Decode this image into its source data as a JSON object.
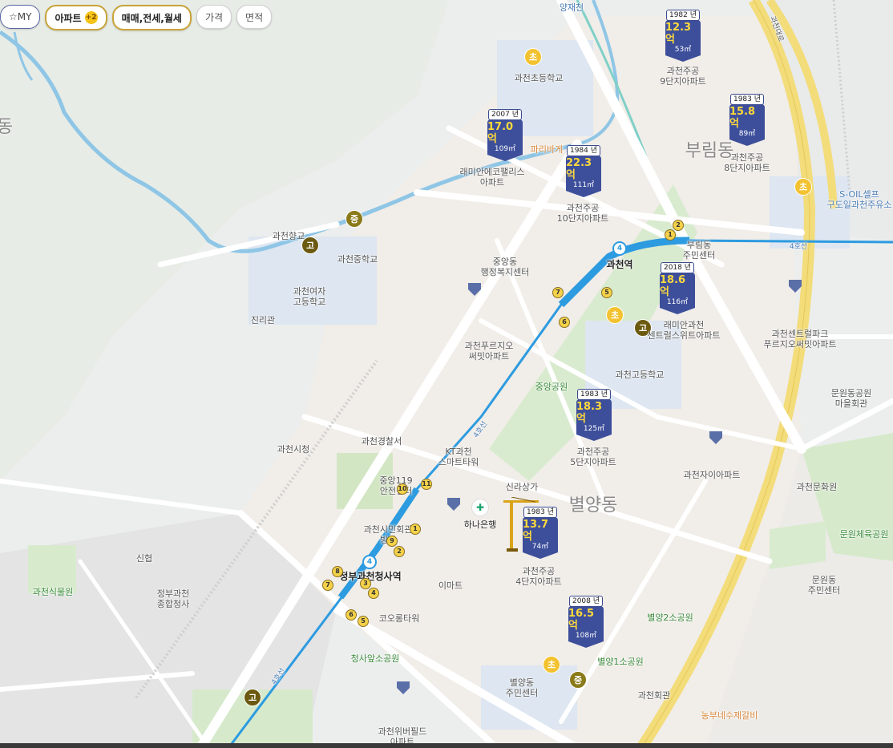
{
  "filters": {
    "my": "MY",
    "apt": "아파트",
    "apt_badge": "+2",
    "trade": "매매,전세,월세",
    "price": "가격",
    "area": "면적"
  },
  "dongs": [
    {
      "name": "부림동"
    },
    {
      "name": "별양동"
    },
    {
      "name": "동"
    }
  ],
  "markers": [
    {
      "year": "1982 년",
      "price": "12.3억",
      "area": "53㎡",
      "name": "과천주공\n9단지아파트"
    },
    {
      "year": "1983 년",
      "price": "15.8억",
      "area": "89㎡",
      "name": "과천주공\n8단지아파트"
    },
    {
      "year": "2007 년",
      "price": "17.0억",
      "area": "109㎡",
      "name": "래미안에코팰리스\n아파트"
    },
    {
      "year": "1984 년",
      "price": "22.3억",
      "area": "111㎡",
      "name": "과천주공\n10단지아파트"
    },
    {
      "year": "2018 년",
      "price": "18.6억",
      "area": "116㎡",
      "name": "래미안과천\n센트럴스위트아파트"
    },
    {
      "year": "1983 년",
      "price": "18.3억",
      "area": "125㎡",
      "name": "과천주공\n5단지아파트"
    },
    {
      "year": "1983 년",
      "price": "13.7억",
      "area": "74㎡",
      "name": "과천주공\n4단지아파트"
    },
    {
      "year": "2008 년",
      "price": "16.5억",
      "area": "108㎡",
      "name": ""
    }
  ],
  "labels": [
    "양재천",
    "과천초등학교",
    "파리바게",
    "과천향교",
    "과천중학교",
    "과천여자\n고등학교",
    "진리관",
    "중앙동\n행정복지센터",
    "과천역",
    "부림동\n주민센터",
    "과천센트럴파크\n푸르지오써밋아파트",
    "S-OIL셀프\n구도일과천주유소",
    "과천푸르지오\n써밋아파트",
    "중앙공원",
    "과천고등학교",
    "과천경찰서",
    "KT과천\n스마트타워",
    "과천시청",
    "중앙119\n안전센터",
    "신라상가",
    "하나은행",
    "과천시민회관\n빙상",
    "신협",
    "정부과천\n종합청사",
    "과천식물원",
    "정부과천청사역",
    "이마트",
    "코오롱타워",
    "청사앞소공원",
    "별양동\n주민센터",
    "별양1소공원",
    "별양2소공원",
    "과천회관",
    "과천자이아파트",
    "문원동공원\n마을회관",
    "과천문화원",
    "문원체육공원",
    "문원동\n주민센터",
    "농부네수제갈비",
    "과천위버필드\n아파트",
    "4호선",
    "4호선",
    "4호선",
    "4호선"
  ],
  "schools": [
    "초",
    "초",
    "초",
    "초",
    "중",
    "중",
    "고",
    "고",
    "고"
  ],
  "station_exits": [
    "1",
    "2",
    "5",
    "6",
    "7",
    "11",
    "10",
    "1",
    "9",
    "2",
    "3",
    "4",
    "5",
    "6",
    "7",
    "8"
  ],
  "line_badges": [
    "4",
    "4"
  ],
  "road_name": "과천대로",
  "colors": {
    "subway": "#2d9be0",
    "marker": "#3d4f9b",
    "price": "#ffd93b",
    "highway": "#f3dc7a"
  }
}
